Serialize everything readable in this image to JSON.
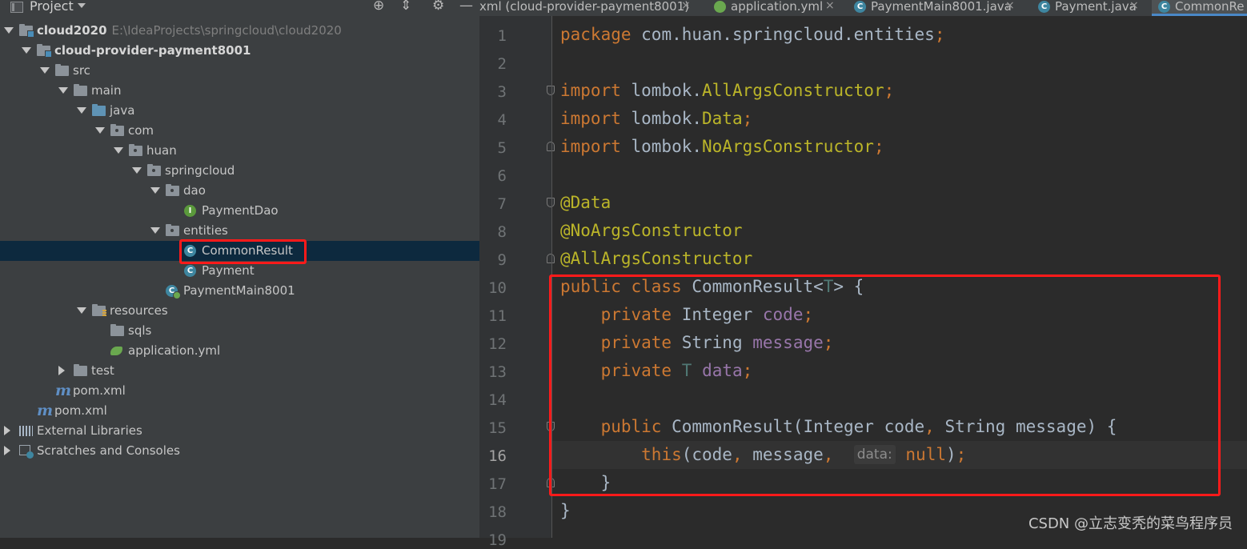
{
  "project_panel": {
    "title": "Project",
    "tree": [
      {
        "label": "cloud2020",
        "path": "E:\\IdeaProjects\\springcloud\\cloud2020",
        "bold": true,
        "level": 0,
        "arrow": "down",
        "icon": "module-folder"
      },
      {
        "label": "cloud-provider-payment8001",
        "bold": true,
        "level": 1,
        "arrow": "down",
        "icon": "module-folder"
      },
      {
        "label": "src",
        "level": 2,
        "arrow": "down",
        "icon": "folder"
      },
      {
        "label": "main",
        "level": 3,
        "arrow": "down",
        "icon": "folder"
      },
      {
        "label": "java",
        "level": 4,
        "arrow": "down",
        "icon": "source-folder"
      },
      {
        "label": "com",
        "level": 5,
        "arrow": "down",
        "icon": "package"
      },
      {
        "label": "huan",
        "level": 6,
        "arrow": "down",
        "icon": "package"
      },
      {
        "label": "springcloud",
        "level": 7,
        "arrow": "down",
        "icon": "package"
      },
      {
        "label": "dao",
        "level": 8,
        "arrow": "down",
        "icon": "package"
      },
      {
        "label": "PaymentDao",
        "level": 9,
        "icon": "interface"
      },
      {
        "label": "entities",
        "level": 8,
        "arrow": "down",
        "icon": "package"
      },
      {
        "label": "CommonResult",
        "level": 9,
        "icon": "class",
        "selected": true
      },
      {
        "label": "Payment",
        "level": 9,
        "icon": "class"
      },
      {
        "label": "PaymentMain8001",
        "level": 8,
        "icon": "spring-class"
      },
      {
        "label": "resources",
        "level": 4,
        "arrow": "down",
        "icon": "resources-folder"
      },
      {
        "label": "sqls",
        "level": 5,
        "icon": "folder"
      },
      {
        "label": "application.yml",
        "level": 5,
        "icon": "spring-yml"
      },
      {
        "label": "test",
        "level": 3,
        "arrow": "right",
        "icon": "folder"
      },
      {
        "label": "pom.xml",
        "level": 2,
        "icon": "maven"
      },
      {
        "label": "pom.xml",
        "level": 1,
        "icon": "maven"
      },
      {
        "label": "External Libraries",
        "level": 0,
        "arrow": "right",
        "icon": "libraries"
      },
      {
        "label": "Scratches and Consoles",
        "level": 0,
        "arrow": "right",
        "icon": "scratches"
      }
    ]
  },
  "tabs": [
    {
      "label": "xml (cloud-provider-payment8001)",
      "icon": "maven",
      "closable": true
    },
    {
      "label": "application.yml",
      "icon": "spring-yml",
      "closable": true
    },
    {
      "label": "PaymentMain8001.java",
      "icon": "spring-class",
      "closable": true
    },
    {
      "label": "Payment.java",
      "icon": "class",
      "closable": true
    },
    {
      "label": "CommonRe",
      "icon": "class",
      "active": true
    }
  ],
  "editor": {
    "current_line": 16,
    "line_numbers": [
      "1",
      "2",
      "3",
      "4",
      "5",
      "6",
      "7",
      "8",
      "9",
      "10",
      "11",
      "12",
      "13",
      "14",
      "15",
      "16",
      "17",
      "18",
      "19"
    ],
    "lines": [
      [
        {
          "t": "package",
          "c": "kw"
        },
        {
          "t": " com.huan.springcloud.entities"
        },
        {
          "t": ";",
          "c": "kw"
        }
      ],
      [],
      [
        {
          "t": "import",
          "c": "kw"
        },
        {
          "t": " lombok."
        },
        {
          "t": "AllArgsConstructor",
          "c": "an"
        },
        {
          "t": ";",
          "c": "kw"
        }
      ],
      [
        {
          "t": "import",
          "c": "kw"
        },
        {
          "t": " lombok."
        },
        {
          "t": "Data",
          "c": "an"
        },
        {
          "t": ";",
          "c": "kw"
        }
      ],
      [
        {
          "t": "import",
          "c": "kw"
        },
        {
          "t": " lombok."
        },
        {
          "t": "NoArgsConstructor",
          "c": "an"
        },
        {
          "t": ";",
          "c": "kw"
        }
      ],
      [],
      [
        {
          "t": "@Data",
          "c": "an"
        }
      ],
      [
        {
          "t": "@NoArgsConstructor",
          "c": "an"
        }
      ],
      [
        {
          "t": "@AllArgsConstructor",
          "c": "an"
        }
      ],
      [
        {
          "t": "public class",
          "c": "kw"
        },
        {
          "t": " CommonResult<"
        },
        {
          "t": "T",
          "c": "tp"
        },
        {
          "t": "> {"
        }
      ],
      [
        {
          "t": "    "
        },
        {
          "t": "private",
          "c": "kw"
        },
        {
          "t": " Integer "
        },
        {
          "t": "code",
          "c": "fld"
        },
        {
          "t": ";",
          "c": "kw"
        }
      ],
      [
        {
          "t": "    "
        },
        {
          "t": "private",
          "c": "kw"
        },
        {
          "t": " String "
        },
        {
          "t": "message",
          "c": "fld"
        },
        {
          "t": ";",
          "c": "kw"
        }
      ],
      [
        {
          "t": "    "
        },
        {
          "t": "private",
          "c": "kw"
        },
        {
          "t": " "
        },
        {
          "t": "T",
          "c": "tp"
        },
        {
          "t": " "
        },
        {
          "t": "data",
          "c": "fld"
        },
        {
          "t": ";",
          "c": "kw"
        }
      ],
      [],
      [
        {
          "t": "    "
        },
        {
          "t": "public",
          "c": "kw"
        },
        {
          "t": " CommonResult(Integer code"
        },
        {
          "t": ",",
          "c": "kw"
        },
        {
          "t": " String message) {"
        }
      ],
      [
        {
          "t": "        "
        },
        {
          "t": "this",
          "c": "kw"
        },
        {
          "t": "(code"
        },
        {
          "t": ",",
          "c": "kw"
        },
        {
          "t": " message"
        },
        {
          "t": ",",
          "c": "kw"
        },
        {
          "t": "  "
        },
        {
          "t": "data:",
          "c": "hint"
        },
        {
          "t": " "
        },
        {
          "t": "null",
          "c": "kw"
        },
        {
          "t": ")"
        },
        {
          "t": ";",
          "c": "kw"
        }
      ],
      [
        {
          "t": "    }"
        }
      ],
      [
        {
          "t": "}"
        }
      ],
      []
    ]
  },
  "watermark": "CSDN @立志变秃的菜鸟程序员",
  "colors": {
    "highlight_box": "#ff1a1a",
    "keyword": "#cc7832",
    "annotation": "#bbb529",
    "field": "#9876aa",
    "selection": "#0d293e"
  }
}
